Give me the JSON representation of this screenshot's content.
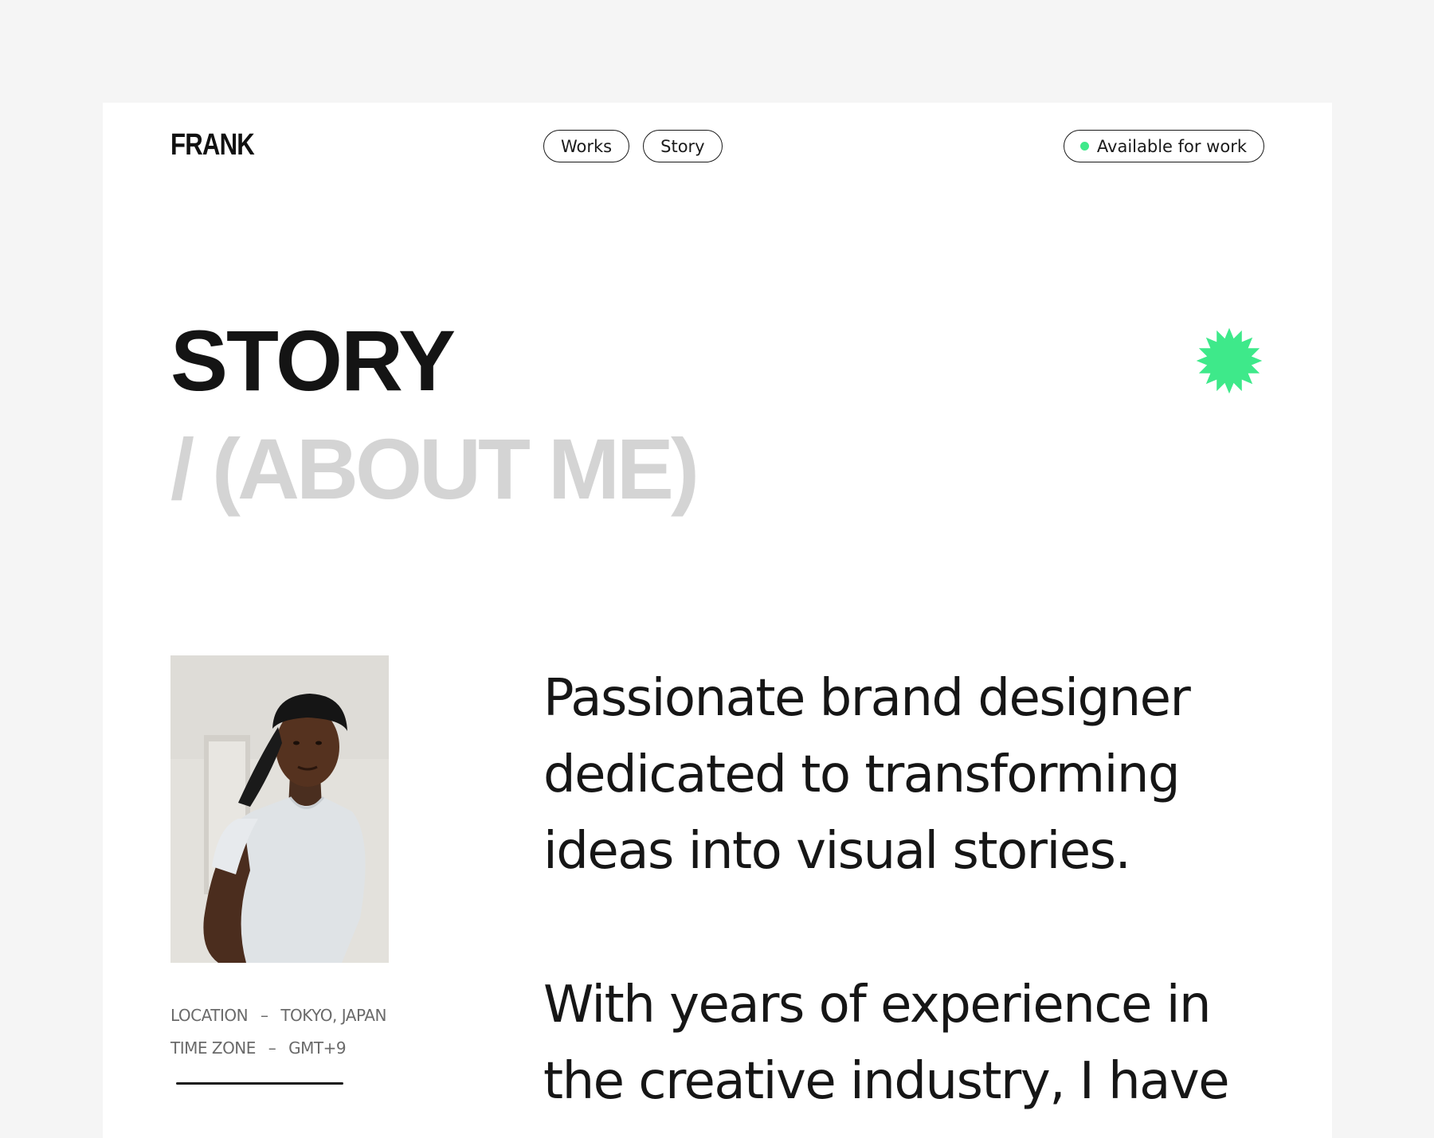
{
  "header": {
    "logo": "FRANK",
    "nav": [
      {
        "label": "Works"
      },
      {
        "label": "Story"
      }
    ],
    "availability_label": "Available for work",
    "availability_color": "#3ee98a"
  },
  "hero": {
    "title": "STORY",
    "subtitle": "/ (ABOUT ME)",
    "accent_icon": "starburst-icon",
    "accent_color": "#3ee98a"
  },
  "profile": {
    "photo_icon": "portrait-photo",
    "location_label": "LOCATION",
    "location_value": "TOKYO, JAPAN",
    "timezone_label": "TIME ZONE",
    "timezone_value": "GMT+9",
    "separator": "–"
  },
  "bio": {
    "paragraph1": "Passionate brand designer dedicated to transforming ideas into visual stories.",
    "paragraph2": "With years of experience in the creative industry, I have"
  }
}
